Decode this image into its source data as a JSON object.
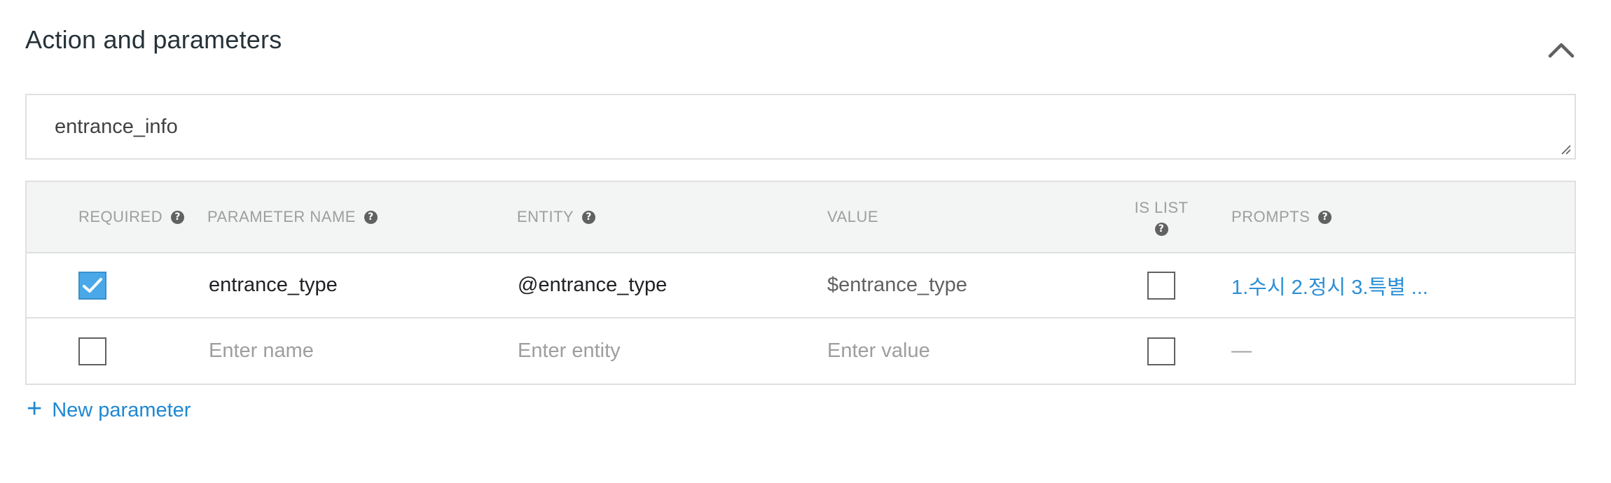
{
  "section": {
    "title": "Action and parameters",
    "collapse_icon": "chevron-up-icon"
  },
  "action": {
    "value": "entrance_info"
  },
  "table": {
    "headers": {
      "required": "REQUIRED",
      "parameter_name": "PARAMETER NAME",
      "entity": "ENTITY",
      "value": "VALUE",
      "is_list": "IS LIST",
      "prompts": "PROMPTS"
    },
    "help_icon": "help-circle-icon",
    "rows": [
      {
        "required": true,
        "name": "entrance_type",
        "entity": "@entrance_type",
        "value": "$entrance_type",
        "is_list": false,
        "prompts": "1.수시 2.정시 3.특별 ..."
      }
    ],
    "new_row": {
      "required": false,
      "name_placeholder": "Enter name",
      "entity_placeholder": "Enter entity",
      "value_placeholder": "Enter value",
      "is_list": false,
      "prompts": "—"
    }
  },
  "new_parameter": {
    "icon": "plus-icon",
    "label": "New parameter"
  },
  "colors": {
    "accent": "#1e88d2",
    "checkbox_checked": "#4aa8e8",
    "header_bg": "#f3f4f4",
    "border": "#e0e0e0"
  }
}
